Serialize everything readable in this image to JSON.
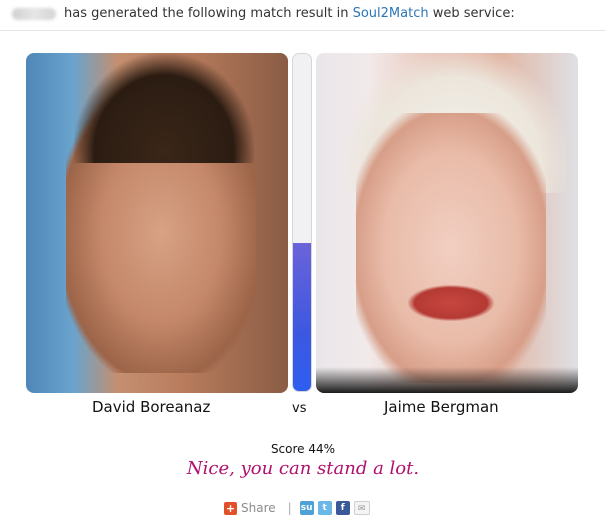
{
  "header": {
    "text_before": "has generated the following match result in",
    "brand": "Soul2Match",
    "text_after": "web service:"
  },
  "match": {
    "left_name": "David Boreanaz",
    "vs": "vs",
    "right_name": "Jaime Bergman",
    "score_label": "Score 44%",
    "score_fraction": 0.44,
    "verdict": "Nice, you can stand a lot."
  },
  "share": {
    "label": "Share",
    "separator": "|",
    "icons": [
      "stumbleupon-icon",
      "twitter-icon",
      "facebook-icon",
      "email-icon"
    ]
  },
  "colors": {
    "brand": "#2a76b8",
    "verdict": "#b0106e",
    "meter_fill": "#3d58e0"
  }
}
